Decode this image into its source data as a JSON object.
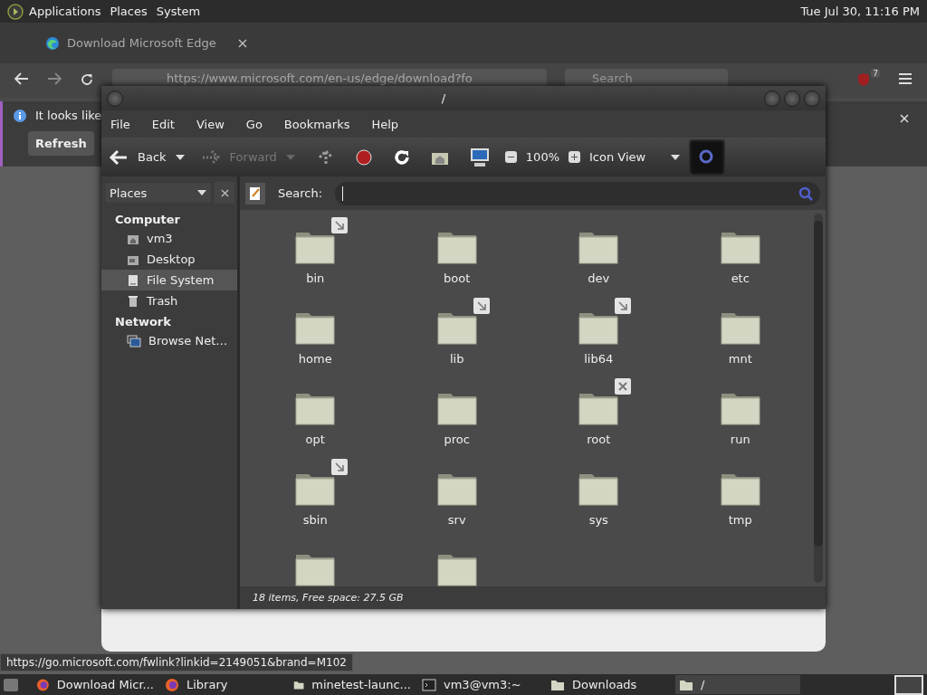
{
  "top_panel": {
    "menus": [
      "Applications",
      "Places",
      "System"
    ],
    "clock": "Tue Jul 30, 11:16 PM"
  },
  "browser": {
    "tab_title": "Download Microsoft Edge",
    "url": "https://www.microsoft.com/en-us/edge/download?fo",
    "search_placeholder": "Search",
    "extension_badge": "7",
    "notice": "It looks like",
    "notice_button": "Refresh",
    "status_url": "https://go.microsoft.com/fwlink?linkid=2149051&brand=M102"
  },
  "file_manager": {
    "title": "/",
    "menu": [
      "File",
      "Edit",
      "View",
      "Go",
      "Bookmarks",
      "Help"
    ],
    "toolbar": {
      "back": {
        "label": "Back",
        "disabled": false
      },
      "forward": {
        "label": "Forward",
        "disabled": true
      },
      "zoom": "100%",
      "view": "Icon View",
      "search_toggle_selected": true
    },
    "sidebar": {
      "selector": "Places",
      "sections": [
        {
          "heading": "Computer",
          "items": [
            {
              "label": "vm3",
              "kind": "home",
              "selected": false
            },
            {
              "label": "Desktop",
              "kind": "desktop",
              "selected": false
            },
            {
              "label": "File System",
              "kind": "drive",
              "selected": true
            },
            {
              "label": "Trash",
              "kind": "trash",
              "selected": false
            }
          ]
        },
        {
          "heading": "Network",
          "items": [
            {
              "label": "Browse Net…",
              "kind": "network",
              "selected": false
            }
          ]
        }
      ]
    },
    "search_label": "Search:",
    "folders": [
      {
        "name": "bin",
        "symlink": true,
        "locked": false
      },
      {
        "name": "boot",
        "symlink": false,
        "locked": false
      },
      {
        "name": "dev",
        "symlink": false,
        "locked": false
      },
      {
        "name": "etc",
        "symlink": false,
        "locked": false
      },
      {
        "name": "home",
        "symlink": false,
        "locked": false
      },
      {
        "name": "lib",
        "symlink": true,
        "locked": false
      },
      {
        "name": "lib64",
        "symlink": true,
        "locked": false
      },
      {
        "name": "mnt",
        "symlink": false,
        "locked": false
      },
      {
        "name": "opt",
        "symlink": false,
        "locked": false
      },
      {
        "name": "proc",
        "symlink": false,
        "locked": false
      },
      {
        "name": "root",
        "symlink": false,
        "locked": true
      },
      {
        "name": "run",
        "symlink": false,
        "locked": false
      },
      {
        "name": "sbin",
        "symlink": true,
        "locked": false
      },
      {
        "name": "srv",
        "symlink": false,
        "locked": false
      },
      {
        "name": "sys",
        "symlink": false,
        "locked": false
      },
      {
        "name": "tmp",
        "symlink": false,
        "locked": false
      },
      {
        "symlink": false,
        "locked": false
      },
      {
        "symlink": false,
        "locked": false
      }
    ],
    "status": "18 items, Free space: 27.5 GB"
  },
  "taskbar": [
    {
      "label": "Download Micr...",
      "kind": "firefox",
      "selected": false
    },
    {
      "label": "Library",
      "kind": "firefox",
      "selected": false
    },
    {
      "label": "minetest-launc...",
      "kind": "folder",
      "selected": false
    },
    {
      "label": "vm3@vm3:~",
      "kind": "terminal",
      "selected": false
    },
    {
      "label": "Downloads",
      "kind": "folder",
      "selected": false
    },
    {
      "label": "/",
      "kind": "folder",
      "selected": true
    }
  ]
}
